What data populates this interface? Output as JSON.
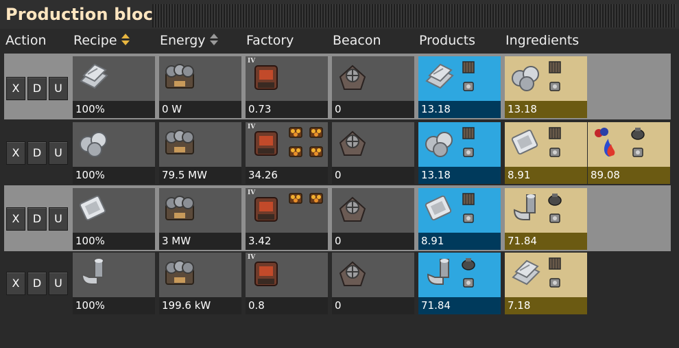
{
  "window": {
    "title": "Production block"
  },
  "columns": {
    "action": "Action",
    "recipe": "Recipe",
    "energy": "Energy",
    "factory": "Factory",
    "beacon": "Beacon",
    "products": "Products",
    "ingredients": "Ingredients"
  },
  "colors": {
    "product_bg": "#2ea7e0",
    "product_label": "#003a5c",
    "ingredient_bg": "#d7c28c",
    "ingredient_label": "#6b5a12",
    "sort_active": "#e8b640",
    "sort_inactive": "#9a9a9a"
  },
  "actions": {
    "remove": "X",
    "down": "D",
    "up": "U"
  },
  "rows": [
    {
      "recipe": {
        "icon": "iron-plate-icon",
        "value": "100%"
      },
      "energy": {
        "icon": "furnace-machine-icon",
        "value": "0 W"
      },
      "factory": {
        "icon": "assembler-icon",
        "tier": "IV",
        "value": "0.73"
      },
      "beacon": {
        "icon": "beacon-icon",
        "value": "0"
      },
      "products": [
        {
          "icon": "iron-plate-icon",
          "value": "13.18"
        }
      ],
      "ingredients": [
        {
          "icon": "iron-ore-icon",
          "value": "13.18"
        }
      ]
    },
    {
      "recipe": {
        "icon": "iron-ore-icon",
        "value": "100%"
      },
      "energy": {
        "icon": "furnace-machine-icon",
        "value": "79.5 MW"
      },
      "factory": {
        "icon": "assembler-icon",
        "tier": "IV",
        "value": "34.26"
      },
      "beacon": {
        "icon": "beacon-icon",
        "value": "0"
      },
      "products": [
        {
          "icon": "iron-ore-icon",
          "value": "13.18"
        }
      ],
      "ingredients": [
        {
          "icon": "plate-icon",
          "value": "8.91"
        },
        {
          "icon": "fuel-icon",
          "value": "89.08"
        }
      ]
    },
    {
      "recipe": {
        "icon": "plate-icon",
        "value": "100%"
      },
      "energy": {
        "icon": "furnace-machine-icon",
        "value": "3 MW"
      },
      "factory": {
        "icon": "assembler-icon",
        "tier": "IV",
        "value": "3.42"
      },
      "beacon": {
        "icon": "beacon-icon",
        "value": "0"
      },
      "products": [
        {
          "icon": "plate-icon",
          "value": "8.91"
        }
      ],
      "ingredients": [
        {
          "icon": "pipe-icon",
          "value": "71.84"
        }
      ]
    },
    {
      "recipe": {
        "icon": "pipe-icon",
        "value": "100%"
      },
      "energy": {
        "icon": "furnace-machine-icon",
        "value": "199.6 kW"
      },
      "factory": {
        "icon": "assembler-icon",
        "tier": "IV",
        "value": "0.8"
      },
      "beacon": {
        "icon": "beacon-icon",
        "value": "0"
      },
      "products": [
        {
          "icon": "pipe-icon",
          "value": "71.84"
        }
      ],
      "ingredients": [
        {
          "icon": "iron-plate-icon",
          "value": "7.18"
        }
      ]
    }
  ]
}
